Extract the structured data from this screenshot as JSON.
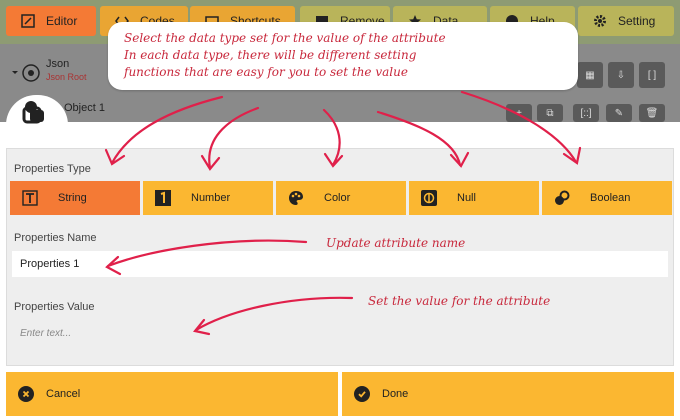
{
  "toolbar": {
    "editor_label": "Editor",
    "codes_label": "Codes",
    "shortcuts_label": "Shortcuts",
    "remove_label": "Remove",
    "data_label": "Data",
    "help_label": "Help",
    "setting_label": "Setting"
  },
  "tree": {
    "root_label": "Json",
    "root_sublabel": "Json Root",
    "child_label": "Object 1"
  },
  "callout": {
    "line1": "Select the data type set for the value of the attribute",
    "line2": "In each data type, there will be different setting",
    "line3": "functions that are easy for you to set the value"
  },
  "dialog": {
    "type_section_label": "Properties Type",
    "types": [
      {
        "label": "String",
        "icon": "text-type-icon",
        "active": true
      },
      {
        "label": "Number",
        "icon": "number-one-icon",
        "active": false
      },
      {
        "label": "Color",
        "icon": "palette-icon",
        "active": false
      },
      {
        "label": "Null",
        "icon": "null-icon",
        "active": false
      },
      {
        "label": "Boolean",
        "icon": "boolean-toggle-icon",
        "active": false
      }
    ],
    "name_section_label": "Properties Name",
    "name_value": "Properties 1",
    "value_section_label": "Properties Value",
    "value_placeholder": "Enter text...",
    "cancel_label": "Cancel",
    "done_label": "Done"
  },
  "annotations": {
    "name_note": "Update attribute name",
    "value_note": "Set the value for the attribute"
  },
  "colors": {
    "accent_active": "#f47a35",
    "accent": "#fbb731",
    "annotation": "#c8283c"
  }
}
